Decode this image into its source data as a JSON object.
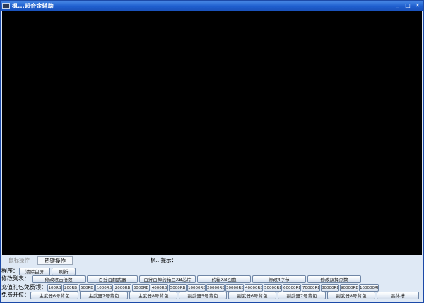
{
  "window": {
    "title": "枫...超合金辅助",
    "minimize": "_",
    "maximize": "□",
    "close": "✕"
  },
  "tabs": {
    "mouse": "鼠标操作",
    "hotkey": "热键操作"
  },
  "hint": "枫...提示：",
  "program": {
    "label": "程序：",
    "buttons": [
      "清除白屏",
      "刷新"
    ]
  },
  "modify": {
    "label": "修改列表：",
    "buttons": [
      "修改攻击倍数",
      "百分百翻武器",
      "百分百掉药箱且XB芯片",
      "药箱XB回血",
      "修改4字节",
      "修改双择点数"
    ]
  },
  "recharge": {
    "label": "充值礼包免费领：",
    "buttons": [
      "100RB",
      "200RB",
      "500RB",
      "1000RB",
      "2000RB",
      "3000RB",
      "4000RB",
      "5000RB",
      "10000RB",
      "20000RB",
      "30000RB",
      "40000RB",
      "50000RB",
      "60000RB",
      "70000RB",
      "80000RB",
      "90000RB",
      "100000RB"
    ]
  },
  "unlock": {
    "label": "免费开位：",
    "buttons": [
      "主武器6号背包",
      "主武器7号背包",
      "主武器8号背包",
      "副武器5号背包",
      "副武器6号背包",
      "副武器7号背包",
      "副武器8号背包",
      "晶体槽"
    ]
  }
}
